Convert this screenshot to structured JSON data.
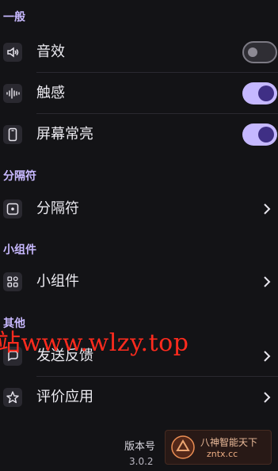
{
  "sections": {
    "general": "一般",
    "divider": "分隔符",
    "widgets": "小组件",
    "other": "其他"
  },
  "rows": {
    "sound": "音效",
    "haptics": "触感",
    "screen_on": "屏幕常亮",
    "divider": "分隔符",
    "widgets": "小组件",
    "feedback": "发送反馈",
    "rate": "评价应用"
  },
  "toggles": {
    "sound": false,
    "haptics": true,
    "screen_on": true
  },
  "version": {
    "label": "版本号",
    "value": "3.0.2"
  },
  "watermark": {
    "text": "站www.wlzy.top",
    "badge_line1": "八神智能天下",
    "badge_line2": "zntx.cc"
  },
  "colors": {
    "background": "#131316",
    "accent": "#c5b8ff",
    "section_title": "#c8b9ff"
  },
  "icons": {
    "sound": "speaker-icon",
    "haptics": "vibration-icon",
    "screen_on": "phone-icon",
    "divider": "divider-icon",
    "widgets": "widgets-icon",
    "feedback": "feedback-icon",
    "rate": "star-icon"
  }
}
